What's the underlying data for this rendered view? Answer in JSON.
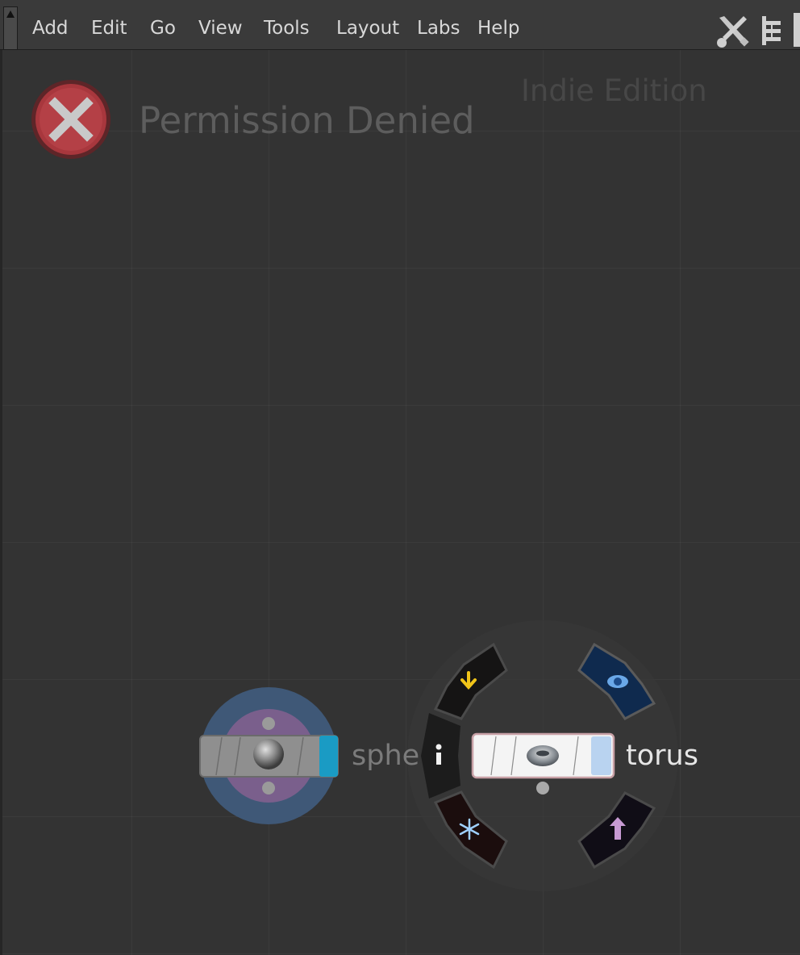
{
  "menubar": {
    "items": [
      {
        "label": "Add"
      },
      {
        "label": "Edit"
      },
      {
        "label": "Go"
      },
      {
        "label": "View"
      },
      {
        "label": "Tools"
      },
      {
        "label": "Layout"
      },
      {
        "label": "Labs"
      },
      {
        "label": "Help"
      }
    ],
    "right_icons": [
      "wrench-screwdriver-icon",
      "tree-view-icon"
    ]
  },
  "network": {
    "error": {
      "icon": "error-x-icon",
      "title": "Permission Denied"
    },
    "watermark": "Indie Edition"
  },
  "nodes": {
    "sphere": {
      "label": "sphere",
      "display_flag_color": "#1a9bc4"
    },
    "torus": {
      "label": "torus",
      "display_flag_color": "#b9d3f0"
    }
  },
  "ring_menu": {
    "items": [
      "lock-icon",
      "display-flag-icon",
      "info-icon",
      "bypass-freeze-icon",
      "template-icon"
    ]
  }
}
